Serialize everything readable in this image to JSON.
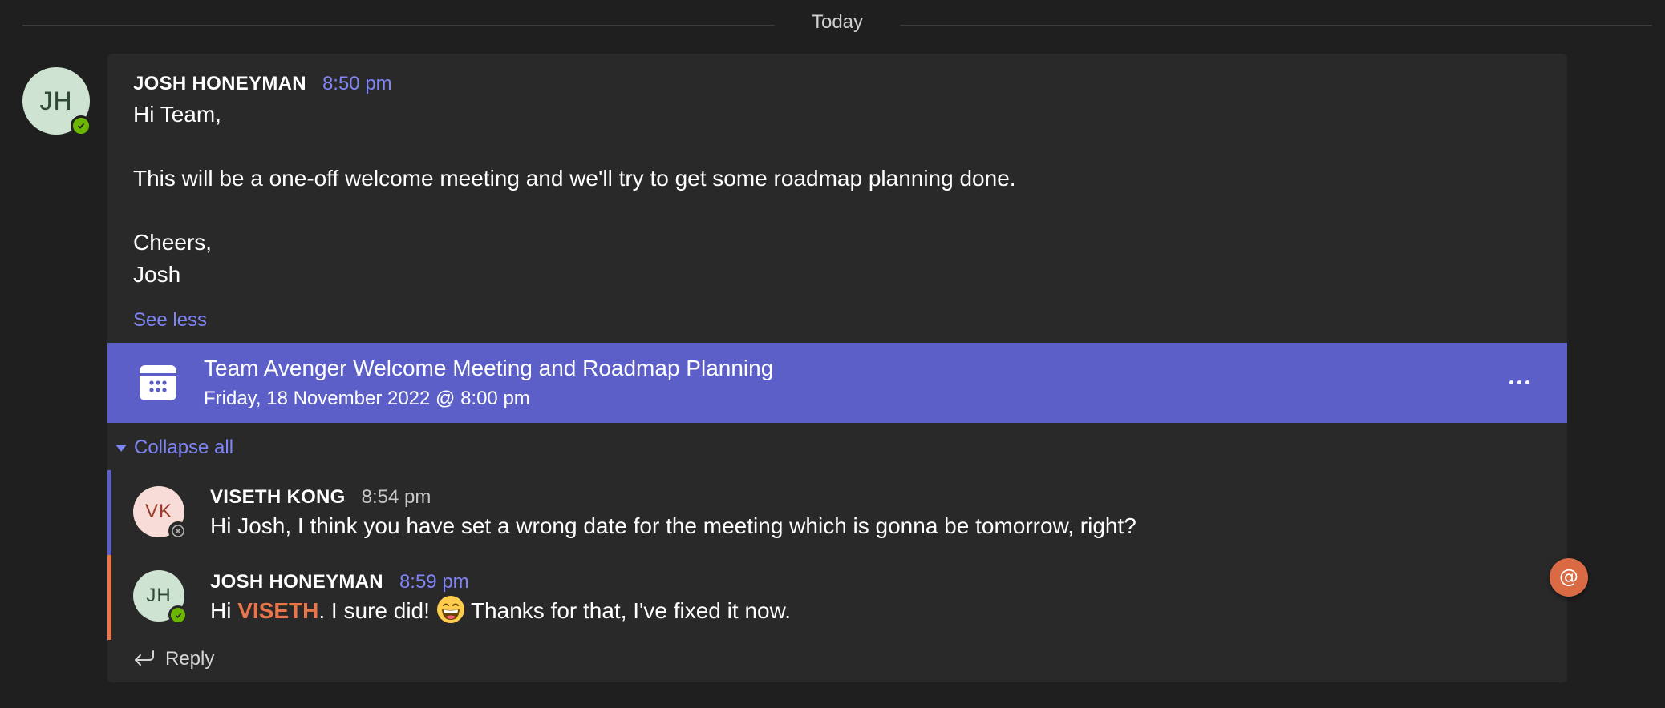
{
  "divider": {
    "label": "Today"
  },
  "post": {
    "avatar_initials": "JH",
    "presence": "available",
    "author": "JOSH HONEYMAN",
    "time": "8:50 pm",
    "lines": [
      "Hi Team,",
      "This will be a one-off welcome meeting and we'll try to get some roadmap planning done.",
      "Cheers,",
      "Josh"
    ],
    "see_less": "See less"
  },
  "meeting": {
    "icon": "calendar-icon",
    "title": "Team Avenger Welcome Meeting and Roadmap Planning",
    "datetime": "Friday, 18 November 2022 @ 8:00 pm",
    "more_icon": "more-options-icon"
  },
  "thread": {
    "collapse_label": "Collapse all",
    "replies": [
      {
        "avatar_initials": "VK",
        "presence": "offline",
        "author": "VISETH KONG",
        "time": "8:54 pm",
        "text": "Hi Josh, I think you have set a wrong date for the meeting which is gonna be tomorrow, right?"
      },
      {
        "avatar_initials": "JH",
        "presence": "available",
        "author": "JOSH HONEYMAN",
        "time": "8:59 pm",
        "text_before": "Hi ",
        "mention": "VISETH",
        "text_mid": ". I sure did! ",
        "emoji": "grinning-face-emoji",
        "text_after": " Thanks for that, I've fixed it now."
      }
    ],
    "reply_label": "Reply"
  },
  "mention_fab": {
    "icon": "at-mention-icon",
    "label": "@"
  },
  "colors": {
    "background": "#1f1f1f",
    "card": "#292929",
    "accent": "#7f85f5",
    "meeting_bar": "#5b5fc7",
    "mention": "#e97548",
    "presence_available": "#6bb700"
  }
}
